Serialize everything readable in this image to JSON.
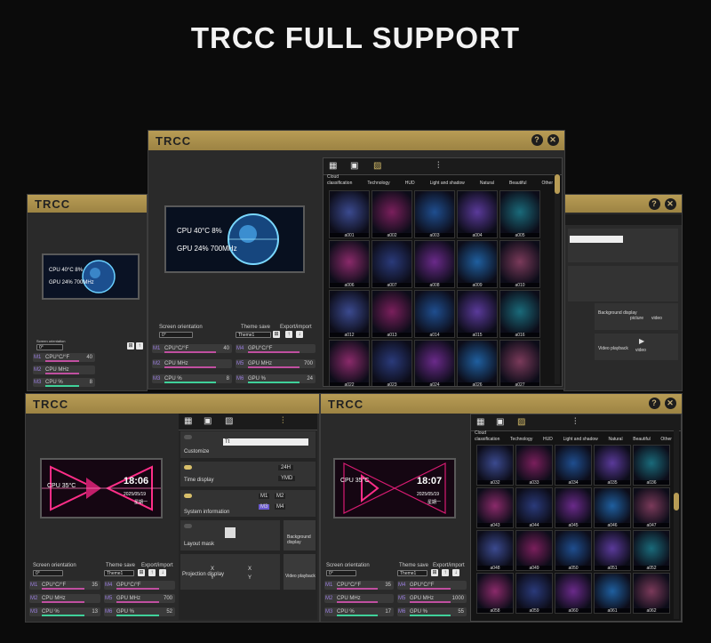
{
  "headline": "TRCC FULL SUPPORT",
  "app_title": "TRCC",
  "title_buttons": {
    "help": "?",
    "close": "✕"
  },
  "common": {
    "screen_orientation": "Screen orientation",
    "orientation_value": "0°",
    "theme_save": "Theme save",
    "theme_value": "Theme1",
    "export_import": "Export/import"
  },
  "center_window": {
    "preview": {
      "line1": "CPU  40°C   8%",
      "line2": "GPU    24%   700MHz"
    },
    "rows_left": [
      {
        "tag": "M1",
        "label": "CPU°C/°F",
        "value": "40"
      },
      {
        "tag": "M2",
        "label": "CPU MHz",
        "value": ""
      },
      {
        "tag": "M3",
        "label": "CPU %",
        "value": "8"
      }
    ],
    "rows_right": [
      {
        "tag": "M4",
        "label": "GPU°C/°F",
        "value": ""
      },
      {
        "tag": "M5",
        "label": "GPU MHz",
        "value": "700"
      },
      {
        "tag": "M6",
        "label": "GPU %",
        "value": "24"
      }
    ],
    "gallery": {
      "cloud": "Cloud",
      "categories": [
        "classification",
        "Technology",
        "HUD",
        "Light and shadow",
        "Natural",
        "Beautiful",
        "Other"
      ],
      "thumbs": [
        "a001",
        "a002",
        "a003",
        "a004",
        "a005",
        "a006",
        "a007",
        "a008",
        "a009",
        "a010",
        "a012",
        "a013",
        "a014",
        "a015",
        "a016",
        "a022",
        "a023",
        "a024",
        "a026",
        "a027"
      ]
    }
  },
  "left_window": {
    "preview": {
      "line1": "CPU  40°C  8%",
      "line2": "GPU    24%   700MHz"
    },
    "rows": [
      {
        "tag": "M1",
        "label": "CPU°C/°F",
        "value": "40"
      },
      {
        "tag": "M2",
        "label": "CPU MHz",
        "value": ""
      },
      {
        "tag": "M3",
        "label": "CPU %",
        "value": "8"
      }
    ]
  },
  "right_window": {
    "items": [
      "Background display",
      "picture",
      "video",
      "Video playback",
      "video"
    ]
  },
  "bottom_left_window": {
    "preview": {
      "line1": "CPU  35°C",
      "time": "18:06",
      "date": "2025/05/19",
      "weekday": "星期一"
    },
    "settings": {
      "customize": "Customize",
      "time_display": "Time display",
      "system_information": "System information",
      "layout_mask": "Layout mask",
      "background_display": "Background display",
      "projection_display": "Projection display",
      "video_playback": "Video playback",
      "text_value": "Tt",
      "time_opts": [
        "24H",
        "YMD"
      ],
      "sys_opts": [
        "M1",
        "M2",
        "M3",
        "M4"
      ],
      "xy_labels": [
        "X",
        "Y",
        "X",
        "Y"
      ]
    },
    "rows_left": [
      {
        "tag": "M1",
        "label": "CPU°C/°F",
        "value": "35"
      },
      {
        "tag": "M2",
        "label": "CPU MHz",
        "value": ""
      },
      {
        "tag": "M3",
        "label": "CPU %",
        "value": "13"
      }
    ],
    "rows_right": [
      {
        "tag": "M4",
        "label": "GPU°C/°F",
        "value": ""
      },
      {
        "tag": "M5",
        "label": "GPU MHz",
        "value": "700"
      },
      {
        "tag": "M6",
        "label": "GPU %",
        "value": "52"
      }
    ]
  },
  "bottom_right_window": {
    "preview": {
      "line1": "CPU  35°C",
      "time": "18:07",
      "date": "2025/05/19",
      "weekday": "星期一"
    },
    "gallery": {
      "cloud": "Cloud",
      "categories": [
        "classification",
        "Technology",
        "HUD",
        "Light and shadow",
        "Natural",
        "Beautiful",
        "Other"
      ],
      "thumbs": [
        "a032",
        "a033",
        "a034",
        "a035",
        "a036",
        "a043",
        "a044",
        "a045",
        "a046",
        "a047",
        "a048",
        "a049",
        "a050",
        "a051",
        "a052",
        "a058",
        "a059",
        "a060",
        "a061",
        "a062"
      ]
    },
    "rows_left": [
      {
        "tag": "M1",
        "label": "CPU°C/°F",
        "value": "35"
      },
      {
        "tag": "M2",
        "label": "CPU MHz",
        "value": ""
      },
      {
        "tag": "M3",
        "label": "CPU %",
        "value": "17"
      }
    ],
    "rows_right": [
      {
        "tag": "M4",
        "label": "GPU°C/°F",
        "value": ""
      },
      {
        "tag": "M5",
        "label": "GPU MHz",
        "value": "1000"
      },
      {
        "tag": "M6",
        "label": "GPU %",
        "value": "55"
      }
    ]
  },
  "colors": {
    "gold": "#b89c55",
    "pink": "#c04fa0",
    "green": "#3fd19a",
    "purple": "#9b7fe0"
  }
}
